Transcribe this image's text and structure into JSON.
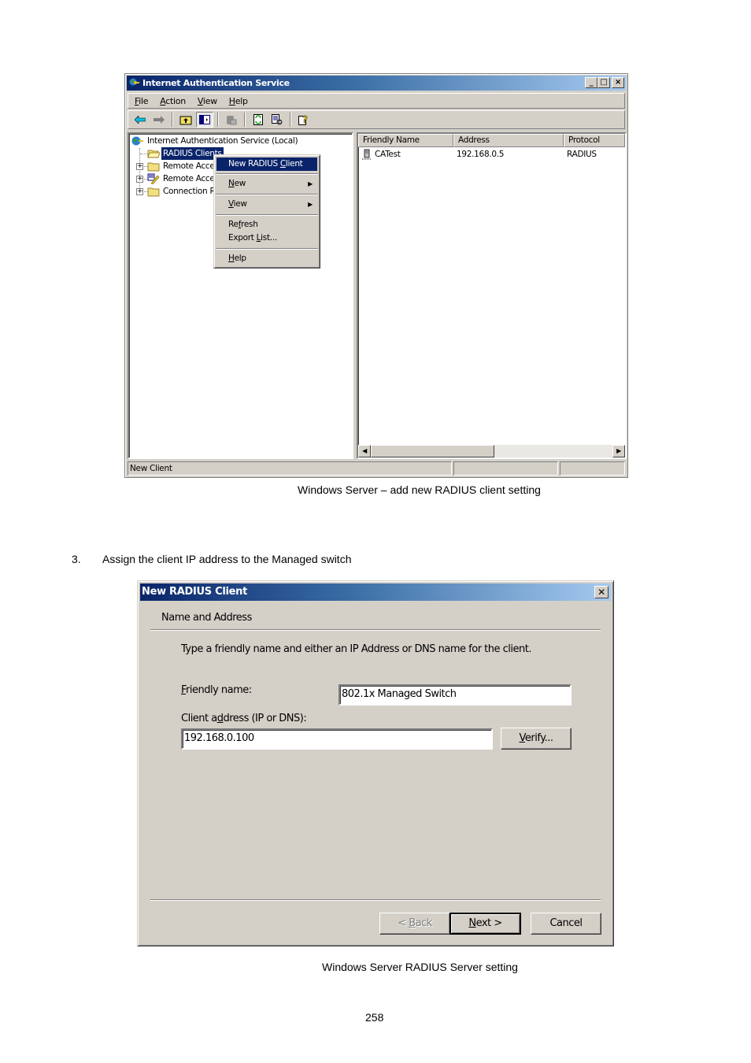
{
  "mmc_window": {
    "title": "Internet Authentication Service",
    "menu": [
      "File",
      "Action",
      "View",
      "Help"
    ],
    "toolbar_icons": [
      "back-arrow",
      "forward-arrow",
      "up-folder",
      "show-hide-tree",
      "delete",
      "refresh",
      "export-list",
      "help"
    ],
    "tree": {
      "root": "Internet Authentication Service (Local)",
      "items": [
        {
          "label": "RADIUS Clients",
          "selected": true
        },
        {
          "label": "Remote Acces",
          "expandable": true
        },
        {
          "label": "Remote Acces",
          "expandable": true
        },
        {
          "label": "Connection R",
          "expandable": true
        }
      ]
    },
    "context_menu": {
      "items": [
        {
          "label": "New RADIUS Client",
          "highlighted": true
        },
        {
          "label": "New",
          "submenu": true
        },
        {
          "label": "View",
          "submenu": true
        },
        {
          "label": "Refresh"
        },
        {
          "label": "Export List..."
        },
        {
          "label": "Help"
        }
      ]
    },
    "list": {
      "columns": [
        "Friendly Name",
        "Address",
        "Protocol"
      ],
      "rows": [
        {
          "name": "CATest",
          "address": "192.168.0.5",
          "protocol": "RADIUS"
        }
      ]
    },
    "status_text": "New Client"
  },
  "caption1": "Windows Server – add new RADIUS client setting",
  "step": {
    "number": "3.",
    "text": "Assign the client IP address to the Managed switch"
  },
  "dialog": {
    "title": "New RADIUS Client",
    "section": "Name and Address",
    "instruction": "Type a friendly name and either an IP Address or DNS name for the client.",
    "friendly_name_label": "Friendly name:",
    "friendly_name_value": "802.1x Managed Switch",
    "client_address_label": "Client address (IP or DNS):",
    "client_address_value": "192.168.0.100",
    "verify_label": "Verify...",
    "back_label": "< Back",
    "next_label": "Next >",
    "cancel_label": "Cancel"
  },
  "caption2": "Windows Server RADIUS Server setting",
  "page_number": "258"
}
